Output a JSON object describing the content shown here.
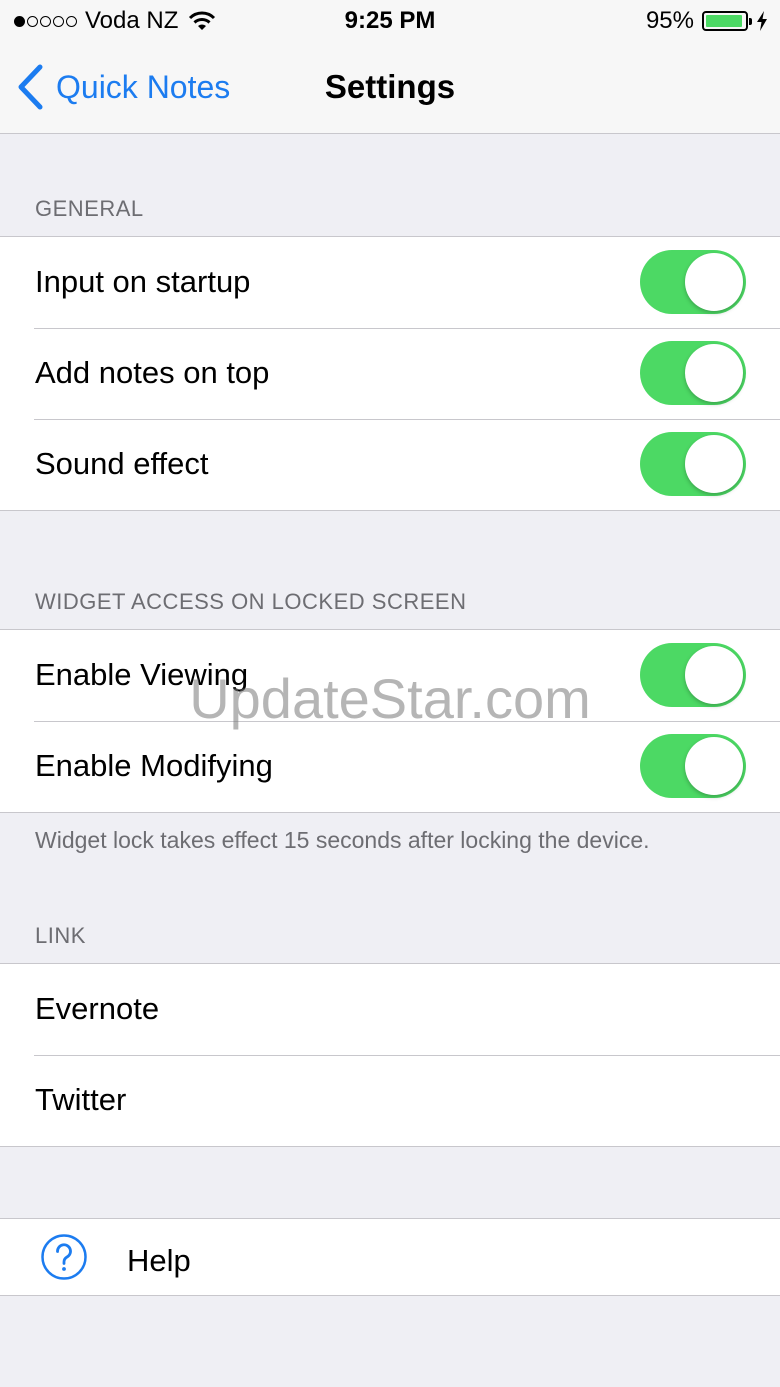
{
  "status_bar": {
    "carrier": "Voda NZ",
    "time": "9:25 PM",
    "battery": "95%",
    "battery_level": 0.95,
    "icons": [
      "signal-dots-icon",
      "wifi-icon",
      "battery-icon",
      "charging-bolt-icon"
    ]
  },
  "nav": {
    "back_label": "Quick Notes",
    "title": "Settings"
  },
  "general": {
    "header": "GENERAL",
    "rows": [
      {
        "label": "Input on startup",
        "on": true
      },
      {
        "label": "Add notes on top",
        "on": true
      },
      {
        "label": "Sound effect",
        "on": true
      }
    ]
  },
  "widget": {
    "header": "WIDGET ACCESS ON LOCKED SCREEN",
    "rows": [
      {
        "label": "Enable Viewing",
        "on": true
      },
      {
        "label": "Enable Modifying",
        "on": true
      }
    ],
    "footer": "Widget lock takes effect 15 seconds after locking the device."
  },
  "link": {
    "header": "LINK",
    "rows": [
      {
        "label": "Evernote"
      },
      {
        "label": "Twitter"
      }
    ]
  },
  "help": {
    "label": "Help",
    "icon": "question-circle-icon"
  },
  "watermark": "UpdateStar.com",
  "colors": {
    "tint": "#1c7cf0",
    "toggle_on": "#4cd964",
    "background": "#efeff4"
  }
}
